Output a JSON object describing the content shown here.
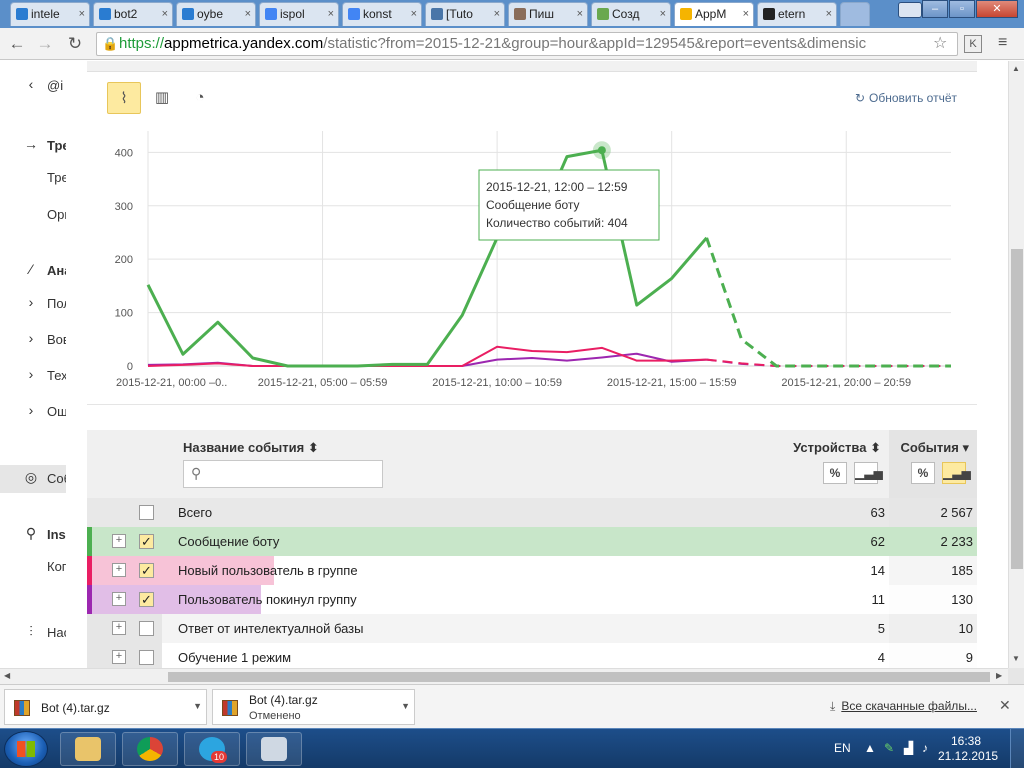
{
  "browser": {
    "tabs": [
      {
        "label": "intele",
        "color": "#2a7cd1"
      },
      {
        "label": "bot2",
        "color": "#2a7cd1"
      },
      {
        "label": "oybe",
        "color": "#2a7cd1"
      },
      {
        "label": "ispol",
        "color": "#4285f4"
      },
      {
        "label": "konst",
        "color": "#4285f4"
      },
      {
        "label": "[Tuto",
        "color": "#4a76a8"
      },
      {
        "label": "Пиш",
        "color": "#8a6d5a"
      },
      {
        "label": "Созд",
        "color": "#6aa84f"
      },
      {
        "label": "AppM",
        "color": "#f5b400"
      },
      {
        "label": "etern",
        "color": "#222222"
      }
    ],
    "url": {
      "scheme": "https://",
      "host": "appmetrica.yandex.com",
      "path": "/statistic?from=2015-12-21&group=hour&appId=129545&report=events&dimensic"
    }
  },
  "sidebar": {
    "items": [
      {
        "icon": "‹",
        "label": "@i",
        "bold": false
      },
      {
        "icon": "→",
        "label": "Тре",
        "bold": true
      },
      {
        "icon": "",
        "label": "Тре",
        "bold": false
      },
      {
        "icon": "",
        "label": "Орг",
        "bold": false
      },
      {
        "icon": "⁄",
        "label": "Ана",
        "bold": true
      },
      {
        "icon": "›",
        "label": "Пол",
        "bold": false
      },
      {
        "icon": "›",
        "label": "Вов",
        "bold": false
      },
      {
        "icon": "›",
        "label": "Тех",
        "bold": false
      },
      {
        "icon": "›",
        "label": "Ош",
        "bold": false
      },
      {
        "icon": "◎",
        "label": "Соб",
        "bold": false
      },
      {
        "icon": "⚲",
        "label": "Ins",
        "bold": true
      },
      {
        "icon": "",
        "label": "Ког",
        "bold": false
      },
      {
        "icon": "⫶",
        "label": "Нас",
        "bold": false
      }
    ]
  },
  "toolbar": {
    "refresh_label": "Обновить отчёт"
  },
  "chart_data": {
    "type": "line",
    "x": [
      "00",
      "01",
      "02",
      "03",
      "04",
      "05",
      "06",
      "07",
      "08",
      "09",
      "10",
      "11",
      "12",
      "13",
      "14",
      "15",
      "16",
      "17",
      "18",
      "19",
      "20",
      "21",
      "22",
      "23"
    ],
    "x_tick_labels": [
      "2015-12-21, 00:00 –0..",
      "2015-12-21, 05:00 – 05:59",
      "2015-12-21, 10:00 – 10:59",
      "2015-12-21, 15:00 – 15:59",
      "2015-12-21, 20:00 – 20:59"
    ],
    "y_ticks": [
      "0",
      "100",
      "200",
      "300",
      "400"
    ],
    "ylim": [
      0,
      440
    ],
    "series": [
      {
        "name": "Сообщение боту",
        "color": "#4caf50",
        "values": [
          152,
          22,
          82,
          15,
          0,
          0,
          0,
          3,
          3,
          95,
          240,
          242,
          392,
          404,
          114,
          164,
          240,
          50,
          0,
          0,
          0,
          0,
          0,
          0
        ],
        "dashed_from": 16
      },
      {
        "name": "Новый пользователь в группе",
        "color": "#e91e63",
        "values": [
          0,
          2,
          5,
          0,
          0,
          0,
          0,
          0,
          0,
          0,
          36,
          28,
          26,
          34,
          10,
          10,
          12,
          5,
          0,
          0,
          0,
          0,
          0,
          0
        ],
        "dashed_from": 16
      },
      {
        "name": "Пользователь покинул группу",
        "color": "#9c27b0",
        "values": [
          2,
          3,
          6,
          0,
          0,
          0,
          0,
          0,
          0,
          0,
          12,
          15,
          10,
          16,
          23,
          8,
          12,
          4,
          0,
          0,
          0,
          0,
          0,
          0
        ],
        "dashed_from": 16
      }
    ],
    "tooltip": {
      "time": "2015-12-21, 12:00 – 12:59",
      "event": "Сообщение боту",
      "count": "Количество событий: 404",
      "point_index": 13
    },
    "grid": true
  },
  "table": {
    "col_name": "Название события",
    "col_devices": "Устройства",
    "col_events": "События",
    "pct_label": "%",
    "search_placeholder": "",
    "rows": [
      {
        "name": "Всего",
        "devices": "63",
        "events": "2 567",
        "checked": false,
        "expandable": false,
        "color": "",
        "fill": 0
      },
      {
        "name": "Сообщение боту",
        "devices": "62",
        "events": "2 233",
        "checked": true,
        "expandable": true,
        "color": "#4caf50",
        "fill": 0.87
      },
      {
        "name": "Новый пользователь в группе",
        "devices": "14",
        "events": "185",
        "checked": true,
        "expandable": true,
        "color": "#e91e63",
        "fill": 0.072
      },
      {
        "name": "Пользователь покинул группу",
        "devices": "11",
        "events": "130",
        "checked": true,
        "expandable": true,
        "color": "#9c27b0",
        "fill": 0.051
      },
      {
        "name": "Ответ от интелектуалной базы",
        "devices": "5",
        "events": "10",
        "checked": false,
        "expandable": true,
        "color": "",
        "fill": 0.004
      },
      {
        "name": "Обучение 1 режим",
        "devices": "4",
        "events": "9",
        "checked": false,
        "expandable": true,
        "color": "",
        "fill": 0.0035
      }
    ]
  },
  "downloads": {
    "items": [
      {
        "name": "Bot (4).tar.gz",
        "status": ""
      },
      {
        "name": "Bot (4).tar.gz",
        "status": "Отменено"
      }
    ],
    "show_all": "Все скачанные файлы..."
  },
  "taskbar": {
    "lang": "EN",
    "time": "16:38",
    "date": "21.12.2015",
    "telegram_badge": "10"
  }
}
